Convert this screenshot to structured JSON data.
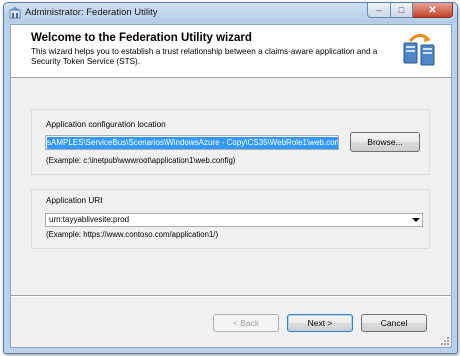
{
  "window": {
    "title": "Administrator: Federation Utility",
    "min_glyph": "–",
    "max_glyph": "□",
    "close_glyph": "✕"
  },
  "header": {
    "title": "Welcome to the Federation Utility wizard",
    "description": "This wizard helps you to establish a trust relationship between a claims-aware application and a Security Token Service (STS)."
  },
  "app_config": {
    "label": "Application configuration location",
    "path_value": "sAMPLES\\ServiceBus\\Scenarios\\WindowsAzure - Copy\\CS35\\WebRole1\\web.config",
    "browse_label": "Browse...",
    "example": "(Example: c:\\inetpub\\wwwroot\\application1\\web.config)"
  },
  "app_uri": {
    "label": "Application URI",
    "value": "urn:tayyablivesite:prod",
    "example": "(Example: https://www.contoso.com/application1/)"
  },
  "buttons": {
    "back": "< Back",
    "next": "Next >",
    "cancel": "Cancel"
  },
  "colors": {
    "selection": "#3399ff",
    "window_frame": "#b9d1ea",
    "dialog_bg": "#f0f0f0"
  }
}
